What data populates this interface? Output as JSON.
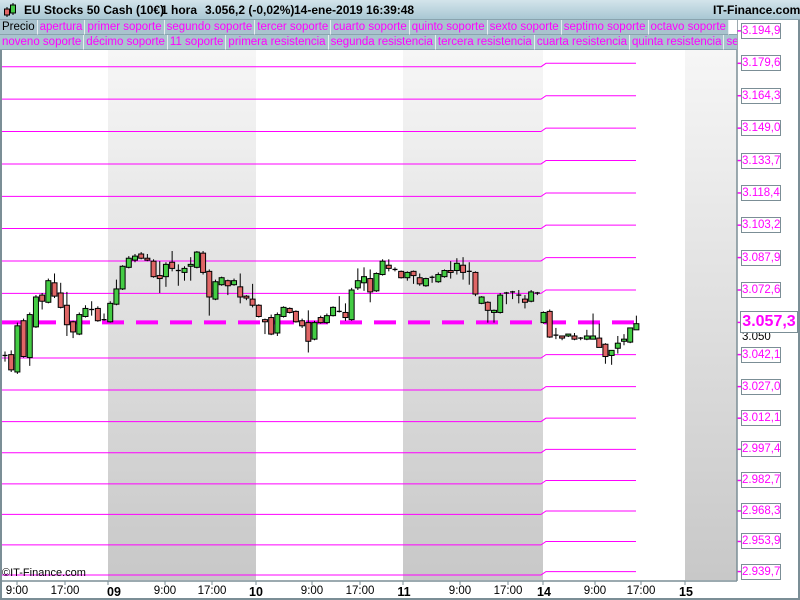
{
  "header": {
    "instrument": "EU Stocks 50 Cash (10€)",
    "timeframe": "1 hora",
    "last_price": "3.056,2 (-0,02%)",
    "datetime": "14-ene-2019 16:39:48",
    "brand": "IT-Finance.com"
  },
  "legend": {
    "row1": [
      "Precio",
      "apertura",
      "primer soporte",
      "segundo soporte",
      "tercer soporte",
      "cuarto soporte",
      "quinto soporte",
      "sexto soporte",
      "septimo soporte",
      "octavo soporte"
    ],
    "row2": [
      "noveno soporte",
      "décimo soporte",
      "11 soporte",
      "primera resistencia",
      "segunda resistencia",
      "tercera resistencia",
      "cuarta resistencia",
      "quinta resistencia",
      "sexta re"
    ]
  },
  "watermark": "©IT-Finance.com",
  "colors": {
    "levels": "#ff00ff",
    "up": "#44cc44",
    "down": "#e06666",
    "outline": "#000000",
    "shade": "#c8c8c8"
  },
  "chart_data": {
    "type": "candlestick",
    "current_price": 3057.3,
    "current_price_label": "3.057,3",
    "y_tick_labels": [
      {
        "label": "3.050",
        "value": 3050
      }
    ],
    "levels": [
      {
        "label": "3.194,9",
        "value": 3194.9
      },
      {
        "label": "3.179,6",
        "value": 3179.6
      },
      {
        "label": "3.164,3",
        "value": 3164.3
      },
      {
        "label": "3.149,0",
        "value": 3149.0
      },
      {
        "label": "3.133,7",
        "value": 3133.7
      },
      {
        "label": "3.118,4",
        "value": 3118.4
      },
      {
        "label": "3.103,2",
        "value": 3103.2
      },
      {
        "label": "3.087,9",
        "value": 3087.9
      },
      {
        "label": "3.072,6",
        "value": 3072.6
      },
      {
        "label": "3.042,1",
        "value": 3042.1
      },
      {
        "label": "3.027,0",
        "value": 3027.0
      },
      {
        "label": "3.012,1",
        "value": 3012.1
      },
      {
        "label": "2.997,4",
        "value": 2997.4
      },
      {
        "label": "2.982,7",
        "value": 2982.7
      },
      {
        "label": "2.968,3",
        "value": 2968.3
      },
      {
        "label": "2.953,9",
        "value": 2953.9
      },
      {
        "label": "2.939,7",
        "value": 2939.7
      }
    ],
    "previous_levels": [
      3193.3,
      3178.0,
      3162.7,
      3147.4,
      3132.1,
      3116.8,
      3101.6,
      3086.3,
      3071.0,
      3040.5,
      3025.4,
      3010.5,
      2995.8,
      2981.1,
      2966.7,
      2952.3,
      2938.1
    ],
    "previous_current_price": 3057.3,
    "x_tick_labels": [
      {
        "label": "9:00",
        "day": false
      },
      {
        "label": "17:00",
        "day": false
      },
      {
        "label": "09",
        "day": true
      },
      {
        "label": "9:00",
        "day": false
      },
      {
        "label": "17:00",
        "day": false
      },
      {
        "label": "10",
        "day": true
      },
      {
        "label": "9:00",
        "day": false
      },
      {
        "label": "17:00",
        "day": false
      },
      {
        "label": "11",
        "day": true
      },
      {
        "label": "9:00",
        "day": false
      },
      {
        "label": "17:00",
        "day": false
      },
      {
        "label": "14",
        "day": true
      },
      {
        "label": "9:00",
        "day": false
      },
      {
        "label": "17:00",
        "day": false
      },
      {
        "label": "15",
        "day": true
      }
    ],
    "ohlc": [
      [
        3041.7,
        3043.6,
        3038.8,
        3041.2
      ],
      [
        3042.1,
        3044.1,
        3033.9,
        3034.9
      ],
      [
        3033.9,
        3057.2,
        3033.0,
        3055.7
      ],
      [
        3058.1,
        3059.1,
        3040.7,
        3041.2
      ],
      [
        3040.7,
        3062.0,
        3036.8,
        3061.0
      ],
      [
        3055.2,
        3070.2,
        3054.7,
        3069.3
      ],
      [
        3070.2,
        3071.2,
        3063.4,
        3067.3
      ],
      [
        3066.8,
        3078.0,
        3066.3,
        3077.0
      ],
      [
        3076.0,
        3080.4,
        3068.8,
        3069.7
      ],
      [
        3071.2,
        3076.0,
        3063.9,
        3064.4
      ],
      [
        3065.4,
        3071.7,
        3050.9,
        3056.2
      ],
      [
        3057.6,
        3058.1,
        3049.9,
        3052.8
      ],
      [
        3051.8,
        3062.0,
        3051.3,
        3061.0
      ],
      [
        3060.1,
        3065.4,
        3059.6,
        3063.9
      ],
      [
        3063.4,
        3067.3,
        3060.5,
        3063.2
      ],
      [
        3063.9,
        3064.9,
        3057.6,
        3058.1
      ],
      [
        3058.6,
        3061.5,
        3058.1,
        3058.4
      ],
      [
        3057.6,
        3067.3,
        3057.2,
        3066.3
      ],
      [
        3065.9,
        3077.5,
        3065.4,
        3073.1
      ],
      [
        3073.1,
        3084.3,
        3072.6,
        3083.8
      ],
      [
        3083.3,
        3088.6,
        3082.8,
        3087.6
      ],
      [
        3086.7,
        3089.6,
        3085.7,
        3088.6
      ],
      [
        3089.6,
        3090.5,
        3087.1,
        3087.6
      ],
      [
        3087.6,
        3089.6,
        3086.2,
        3086.7
      ],
      [
        3086.2,
        3087.1,
        3078.4,
        3078.9
      ],
      [
        3079.4,
        3086.2,
        3071.2,
        3078.0
      ],
      [
        3078.9,
        3085.7,
        3074.1,
        3084.7
      ],
      [
        3085.7,
        3091.0,
        3081.4,
        3082.8
      ],
      [
        3081.8,
        3084.7,
        3074.6,
        3081.6
      ],
      [
        3080.9,
        3083.8,
        3077.0,
        3082.8
      ],
      [
        3083.8,
        3088.1,
        3077.0,
        3084.7
      ],
      [
        3083.3,
        3091.0,
        3082.8,
        3090.5
      ],
      [
        3090.0,
        3091.0,
        3079.9,
        3080.9
      ],
      [
        3081.4,
        3082.3,
        3060.5,
        3069.3
      ],
      [
        3068.3,
        3077.5,
        3067.8,
        3076.5
      ],
      [
        3075.1,
        3078.9,
        3074.6,
        3078.4
      ],
      [
        3077.0,
        3077.5,
        3070.2,
        3074.6
      ],
      [
        3075.1,
        3078.0,
        3074.6,
        3077.0
      ],
      [
        3074.1,
        3080.4,
        3066.3,
        3069.3
      ],
      [
        3069.7,
        3070.2,
        3067.8,
        3068.8
      ],
      [
        3068.3,
        3075.5,
        3064.4,
        3065.4
      ],
      [
        3065.4,
        3065.9,
        3059.6,
        3060.1
      ],
      [
        3058.6,
        3059.1,
        3051.8,
        3057.6
      ],
      [
        3059.6,
        3061.0,
        3051.3,
        3051.8
      ],
      [
        3052.3,
        3062.0,
        3050.9,
        3061.0
      ],
      [
        3060.1,
        3064.9,
        3059.6,
        3064.4
      ],
      [
        3063.9,
        3064.4,
        3061.5,
        3062.0
      ],
      [
        3062.5,
        3063.0,
        3057.2,
        3057.6
      ],
      [
        3058.1,
        3059.1,
        3054.7,
        3055.7
      ],
      [
        3057.2,
        3063.0,
        3043.1,
        3048.4
      ],
      [
        3049.4,
        3058.1,
        3048.9,
        3057.2
      ],
      [
        3059.6,
        3060.5,
        3056.7,
        3057.2
      ],
      [
        3057.2,
        3061.5,
        3056.7,
        3060.5
      ],
      [
        3060.5,
        3064.9,
        3060.1,
        3064.4
      ],
      [
        3062.5,
        3069.7,
        3062.0,
        3062.3
      ],
      [
        3062.0,
        3066.3,
        3058.1,
        3059.6
      ],
      [
        3058.6,
        3073.6,
        3058.1,
        3072.6
      ],
      [
        3073.6,
        3082.8,
        3072.6,
        3077.0
      ],
      [
        3076.0,
        3083.3,
        3072.2,
        3078.9
      ],
      [
        3078.0,
        3082.3,
        3066.8,
        3071.7
      ],
      [
        3072.2,
        3080.9,
        3071.7,
        3080.4
      ],
      [
        3079.9,
        3087.1,
        3079.4,
        3086.2
      ],
      [
        3084.3,
        3087.1,
        3081.4,
        3082.8
      ],
      [
        3082.3,
        3083.3,
        3081.4,
        3082.0
      ],
      [
        3081.4,
        3081.8,
        3078.0,
        3078.4
      ],
      [
        3078.4,
        3081.4,
        3077.0,
        3080.9
      ],
      [
        3081.4,
        3081.8,
        3075.5,
        3079.4
      ],
      [
        3078.4,
        3080.4,
        3074.6,
        3075.5
      ],
      [
        3074.6,
        3078.4,
        3074.1,
        3078.0
      ],
      [
        3078.4,
        3079.4,
        3076.0,
        3078.6
      ],
      [
        3076.5,
        3080.9,
        3076.0,
        3079.9
      ],
      [
        3078.9,
        3082.3,
        3078.4,
        3081.8
      ],
      [
        3081.8,
        3086.2,
        3078.0,
        3080.9
      ],
      [
        3081.8,
        3087.6,
        3079.9,
        3085.2
      ],
      [
        3084.3,
        3088.1,
        3077.5,
        3080.9
      ],
      [
        3081.4,
        3085.7,
        3075.1,
        3081.2
      ],
      [
        3080.9,
        3081.4,
        3069.7,
        3070.7
      ],
      [
        3066.3,
        3069.7,
        3065.9,
        3069.3
      ],
      [
        3066.8,
        3067.3,
        3057.2,
        3063.0
      ],
      [
        3062.0,
        3063.4,
        3057.2,
        3063.0
      ],
      [
        3062.0,
        3071.2,
        3061.5,
        3070.2
      ],
      [
        3071.2,
        3071.7,
        3065.9,
        3071.0
      ],
      [
        3071.7,
        3072.2,
        3068.3,
        3071.2
      ],
      [
        3070.2,
        3072.6,
        3066.3,
        3070.0
      ],
      [
        3068.3,
        3070.2,
        3063.9,
        3066.8
      ],
      [
        3067.3,
        3072.6,
        3066.8,
        3071.7
      ],
      [
        3071.2,
        3071.7,
        3070.2,
        3071.2
      ],
      [
        3057.2,
        3062.5,
        3056.7,
        3062.0
      ],
      [
        3062.5,
        3063.4,
        3050.0,
        3050.4
      ],
      [
        3051.3,
        3054.7,
        3049.4,
        3051.1
      ],
      [
        3050.9,
        3050.9,
        3048.9,
        3049.9
      ],
      [
        3050.9,
        3051.8,
        3050.4,
        3051.8
      ],
      [
        3050.9,
        3052.3,
        3048.9,
        3049.4
      ],
      [
        3049.9,
        3050.4,
        3048.9,
        3049.9
      ],
      [
        3049.4,
        3053.8,
        3048.9,
        3050.9
      ],
      [
        3049.4,
        3061.5,
        3049.4,
        3050.9
      ],
      [
        3049.9,
        3056.7,
        3045.5,
        3045.5
      ],
      [
        3047.0,
        3047.5,
        3037.8,
        3041.2
      ],
      [
        3041.7,
        3044.1,
        3037.3,
        3044.1
      ],
      [
        3045.1,
        3050.9,
        3042.6,
        3047.5
      ],
      [
        3048.4,
        3051.8,
        3046.5,
        3049.4
      ],
      [
        3048.0,
        3054.7,
        3047.5,
        3054.7
      ],
      [
        3053.8,
        3060.5,
        3053.8,
        3056.7
      ]
    ]
  }
}
